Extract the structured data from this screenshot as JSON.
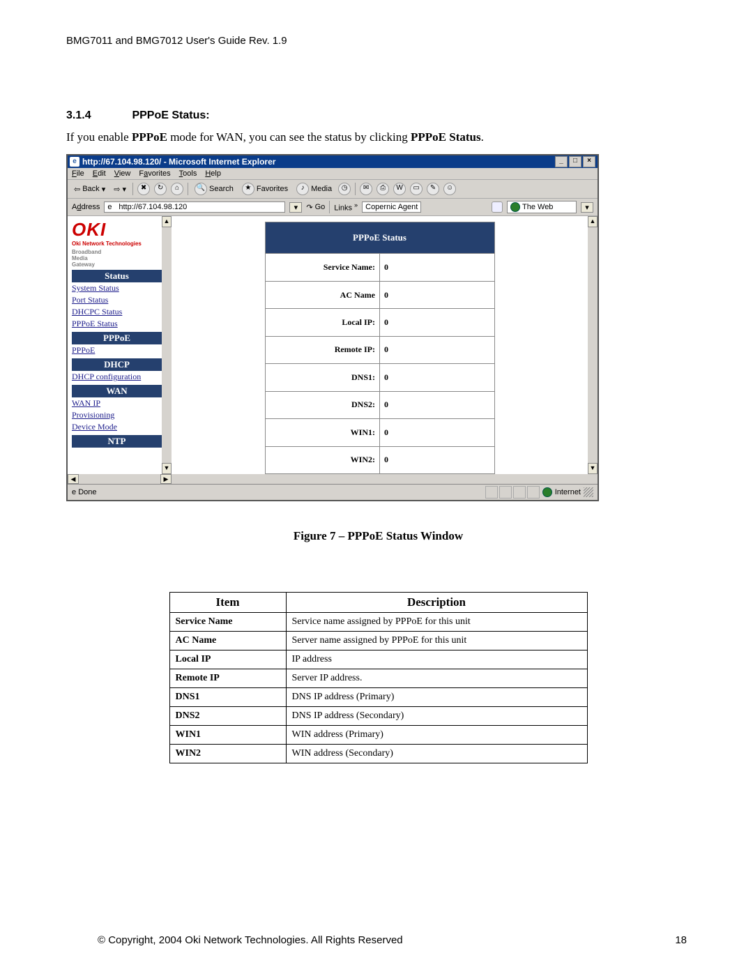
{
  "doc": {
    "header": "BMG7011 and BMG7012 User's Guide Rev. 1.9",
    "section_num": "3.1.4",
    "section_title": "PPPoE Status:",
    "intro_pre": "If you enable ",
    "intro_b1": "PPPoE",
    "intro_mid": " mode for WAN, you can see the status by clicking ",
    "intro_b2": "PPPoE Status",
    "intro_post": ".",
    "figure_caption": "Figure 7 – PPPoE Status Window",
    "footer_copy": "© Copyright, 2004 Oki Network Technologies. All Rights Reserved",
    "page_num": "18"
  },
  "ie": {
    "title": "http://67.104.98.120/ - Microsoft Internet Explorer",
    "menu": [
      "File",
      "Edit",
      "View",
      "Favorites",
      "Tools",
      "Help"
    ],
    "toolbar": {
      "back": "Back",
      "search": "Search",
      "favorites": "Favorites",
      "media": "Media"
    },
    "address_label": "Address",
    "address_value": "http://67.104.98.120",
    "go": "Go",
    "links": "Links",
    "copernic": "Copernic Agent",
    "theweb": "The Web",
    "status_done": "Done",
    "status_zone": "Internet"
  },
  "router": {
    "logo": "OKI",
    "logo_tag": "Oki Network Technologies",
    "logo_sub": "Broadband\nMedia\nGateway",
    "nav": {
      "status_head": "Status",
      "status_links": [
        "System Status",
        "Port Status",
        "DHCPC Status",
        "PPPoE Status"
      ],
      "pppoe_head": "PPPoE",
      "pppoe_links": [
        "PPPoE"
      ],
      "dhcp_head": "DHCP",
      "dhcp_links": [
        "DHCP configuration"
      ],
      "wan_head": "WAN",
      "wan_links": [
        "WAN IP",
        "Provisioning",
        "Device Mode"
      ],
      "ntp_head": "NTP"
    },
    "table_title": "PPPoE Status",
    "rows": [
      {
        "label": "Service Name:",
        "val": "0"
      },
      {
        "label": "AC Name",
        "val": "0"
      },
      {
        "label": "Local IP:",
        "val": "0"
      },
      {
        "label": "Remote IP:",
        "val": "0"
      },
      {
        "label": "DNS1:",
        "val": "0"
      },
      {
        "label": "DNS2:",
        "val": "0"
      },
      {
        "label": "WIN1:",
        "val": "0"
      },
      {
        "label": "WIN2:",
        "val": "0"
      }
    ]
  },
  "desc": {
    "head_item": "Item",
    "head_desc": "Description",
    "rows": [
      {
        "item": "Service Name",
        "desc": "Service name assigned by PPPoE for this unit"
      },
      {
        "item": "AC Name",
        "desc": "Server name assigned by PPPoE for this unit"
      },
      {
        "item": "Local IP",
        "desc": "IP address"
      },
      {
        "item": "Remote IP",
        "desc": "Server IP address."
      },
      {
        "item": "DNS1",
        "desc": "DNS IP address (Primary)"
      },
      {
        "item": "DNS2",
        "desc": "DNS IP address (Secondary)"
      },
      {
        "item": "WIN1",
        "desc": "WIN address (Primary)"
      },
      {
        "item": "WIN2",
        "desc": "WIN address (Secondary)"
      }
    ]
  }
}
